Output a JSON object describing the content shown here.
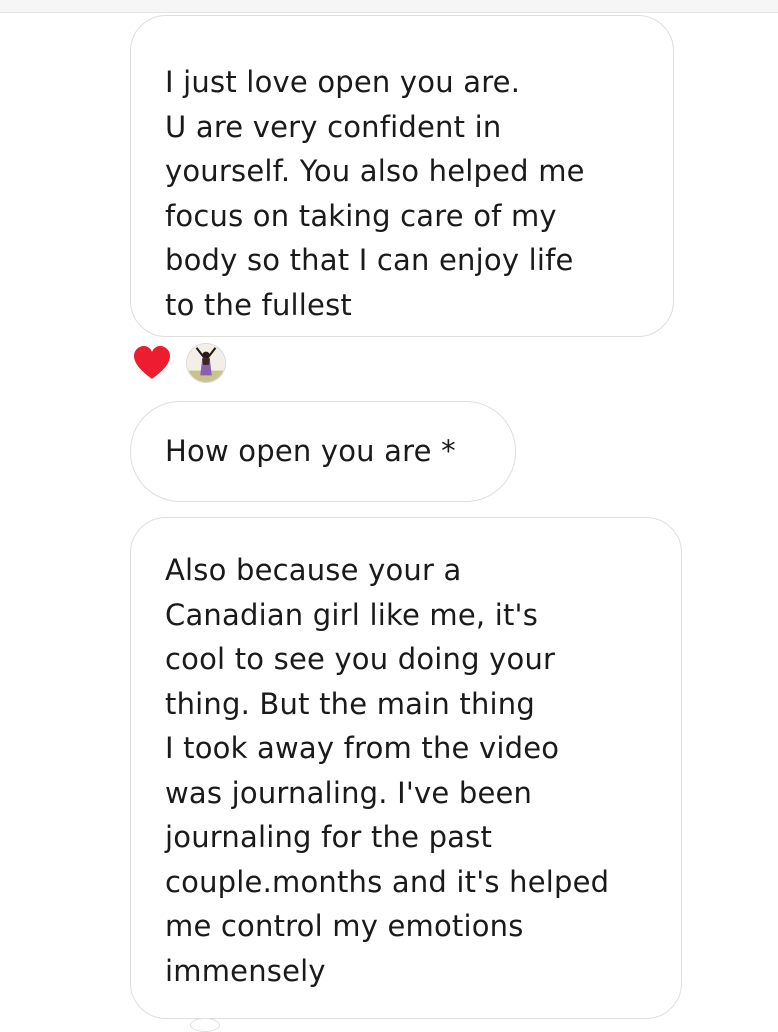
{
  "messages": [
    {
      "text": "I just love open you are.\nU are very confident in\nyourself. You also helped me\nfocus on taking care of my\nbody so that I can enjoy life\nto the fullest"
    },
    {
      "text": "How open you are *"
    },
    {
      "text": "Also because your a\nCanadian girl like me, it's\ncool to see you doing your\nthing. But the main thing\nI took away from the video\nwas journaling. I've been\njournaling for the past\ncouple.months and it's helped\nme control my emotions\nimmensely"
    }
  ],
  "reactions": {
    "icon": "heart-icon",
    "color": "#ed1c2e"
  },
  "colors": {
    "bubble_border": "#dedede",
    "text": "#1a1a1a",
    "background": "#ffffff"
  }
}
